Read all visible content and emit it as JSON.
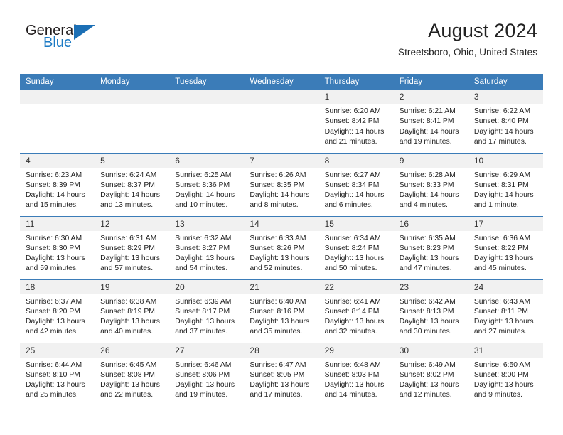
{
  "brand": {
    "name_part1": "General",
    "name_part2": "Blue",
    "triangle_color": "#1b6fb5",
    "blue_text_color": "#1b7ac4"
  },
  "header": {
    "month_title": "August 2024",
    "location": "Streetsboro, Ohio, United States",
    "header_bg_color": "#3b7cb8",
    "daynum_bg_color": "#f1f1f1"
  },
  "weekday_headers": [
    "Sunday",
    "Monday",
    "Tuesday",
    "Wednesday",
    "Thursday",
    "Friday",
    "Saturday"
  ],
  "weeks": [
    [
      {
        "day": "",
        "lines": []
      },
      {
        "day": "",
        "lines": []
      },
      {
        "day": "",
        "lines": []
      },
      {
        "day": "",
        "lines": []
      },
      {
        "day": "1",
        "lines": [
          "Sunrise: 6:20 AM",
          "Sunset: 8:42 PM",
          "Daylight: 14 hours",
          "and 21 minutes."
        ]
      },
      {
        "day": "2",
        "lines": [
          "Sunrise: 6:21 AM",
          "Sunset: 8:41 PM",
          "Daylight: 14 hours",
          "and 19 minutes."
        ]
      },
      {
        "day": "3",
        "lines": [
          "Sunrise: 6:22 AM",
          "Sunset: 8:40 PM",
          "Daylight: 14 hours",
          "and 17 minutes."
        ]
      }
    ],
    [
      {
        "day": "4",
        "lines": [
          "Sunrise: 6:23 AM",
          "Sunset: 8:39 PM",
          "Daylight: 14 hours",
          "and 15 minutes."
        ]
      },
      {
        "day": "5",
        "lines": [
          "Sunrise: 6:24 AM",
          "Sunset: 8:37 PM",
          "Daylight: 14 hours",
          "and 13 minutes."
        ]
      },
      {
        "day": "6",
        "lines": [
          "Sunrise: 6:25 AM",
          "Sunset: 8:36 PM",
          "Daylight: 14 hours",
          "and 10 minutes."
        ]
      },
      {
        "day": "7",
        "lines": [
          "Sunrise: 6:26 AM",
          "Sunset: 8:35 PM",
          "Daylight: 14 hours",
          "and 8 minutes."
        ]
      },
      {
        "day": "8",
        "lines": [
          "Sunrise: 6:27 AM",
          "Sunset: 8:34 PM",
          "Daylight: 14 hours",
          "and 6 minutes."
        ]
      },
      {
        "day": "9",
        "lines": [
          "Sunrise: 6:28 AM",
          "Sunset: 8:33 PM",
          "Daylight: 14 hours",
          "and 4 minutes."
        ]
      },
      {
        "day": "10",
        "lines": [
          "Sunrise: 6:29 AM",
          "Sunset: 8:31 PM",
          "Daylight: 14 hours",
          "and 1 minute."
        ]
      }
    ],
    [
      {
        "day": "11",
        "lines": [
          "Sunrise: 6:30 AM",
          "Sunset: 8:30 PM",
          "Daylight: 13 hours",
          "and 59 minutes."
        ]
      },
      {
        "day": "12",
        "lines": [
          "Sunrise: 6:31 AM",
          "Sunset: 8:29 PM",
          "Daylight: 13 hours",
          "and 57 minutes."
        ]
      },
      {
        "day": "13",
        "lines": [
          "Sunrise: 6:32 AM",
          "Sunset: 8:27 PM",
          "Daylight: 13 hours",
          "and 54 minutes."
        ]
      },
      {
        "day": "14",
        "lines": [
          "Sunrise: 6:33 AM",
          "Sunset: 8:26 PM",
          "Daylight: 13 hours",
          "and 52 minutes."
        ]
      },
      {
        "day": "15",
        "lines": [
          "Sunrise: 6:34 AM",
          "Sunset: 8:24 PM",
          "Daylight: 13 hours",
          "and 50 minutes."
        ]
      },
      {
        "day": "16",
        "lines": [
          "Sunrise: 6:35 AM",
          "Sunset: 8:23 PM",
          "Daylight: 13 hours",
          "and 47 minutes."
        ]
      },
      {
        "day": "17",
        "lines": [
          "Sunrise: 6:36 AM",
          "Sunset: 8:22 PM",
          "Daylight: 13 hours",
          "and 45 minutes."
        ]
      }
    ],
    [
      {
        "day": "18",
        "lines": [
          "Sunrise: 6:37 AM",
          "Sunset: 8:20 PM",
          "Daylight: 13 hours",
          "and 42 minutes."
        ]
      },
      {
        "day": "19",
        "lines": [
          "Sunrise: 6:38 AM",
          "Sunset: 8:19 PM",
          "Daylight: 13 hours",
          "and 40 minutes."
        ]
      },
      {
        "day": "20",
        "lines": [
          "Sunrise: 6:39 AM",
          "Sunset: 8:17 PM",
          "Daylight: 13 hours",
          "and 37 minutes."
        ]
      },
      {
        "day": "21",
        "lines": [
          "Sunrise: 6:40 AM",
          "Sunset: 8:16 PM",
          "Daylight: 13 hours",
          "and 35 minutes."
        ]
      },
      {
        "day": "22",
        "lines": [
          "Sunrise: 6:41 AM",
          "Sunset: 8:14 PM",
          "Daylight: 13 hours",
          "and 32 minutes."
        ]
      },
      {
        "day": "23",
        "lines": [
          "Sunrise: 6:42 AM",
          "Sunset: 8:13 PM",
          "Daylight: 13 hours",
          "and 30 minutes."
        ]
      },
      {
        "day": "24",
        "lines": [
          "Sunrise: 6:43 AM",
          "Sunset: 8:11 PM",
          "Daylight: 13 hours",
          "and 27 minutes."
        ]
      }
    ],
    [
      {
        "day": "25",
        "lines": [
          "Sunrise: 6:44 AM",
          "Sunset: 8:10 PM",
          "Daylight: 13 hours",
          "and 25 minutes."
        ]
      },
      {
        "day": "26",
        "lines": [
          "Sunrise: 6:45 AM",
          "Sunset: 8:08 PM",
          "Daylight: 13 hours",
          "and 22 minutes."
        ]
      },
      {
        "day": "27",
        "lines": [
          "Sunrise: 6:46 AM",
          "Sunset: 8:06 PM",
          "Daylight: 13 hours",
          "and 19 minutes."
        ]
      },
      {
        "day": "28",
        "lines": [
          "Sunrise: 6:47 AM",
          "Sunset: 8:05 PM",
          "Daylight: 13 hours",
          "and 17 minutes."
        ]
      },
      {
        "day": "29",
        "lines": [
          "Sunrise: 6:48 AM",
          "Sunset: 8:03 PM",
          "Daylight: 13 hours",
          "and 14 minutes."
        ]
      },
      {
        "day": "30",
        "lines": [
          "Sunrise: 6:49 AM",
          "Sunset: 8:02 PM",
          "Daylight: 13 hours",
          "and 12 minutes."
        ]
      },
      {
        "day": "31",
        "lines": [
          "Sunrise: 6:50 AM",
          "Sunset: 8:00 PM",
          "Daylight: 13 hours",
          "and 9 minutes."
        ]
      }
    ]
  ]
}
